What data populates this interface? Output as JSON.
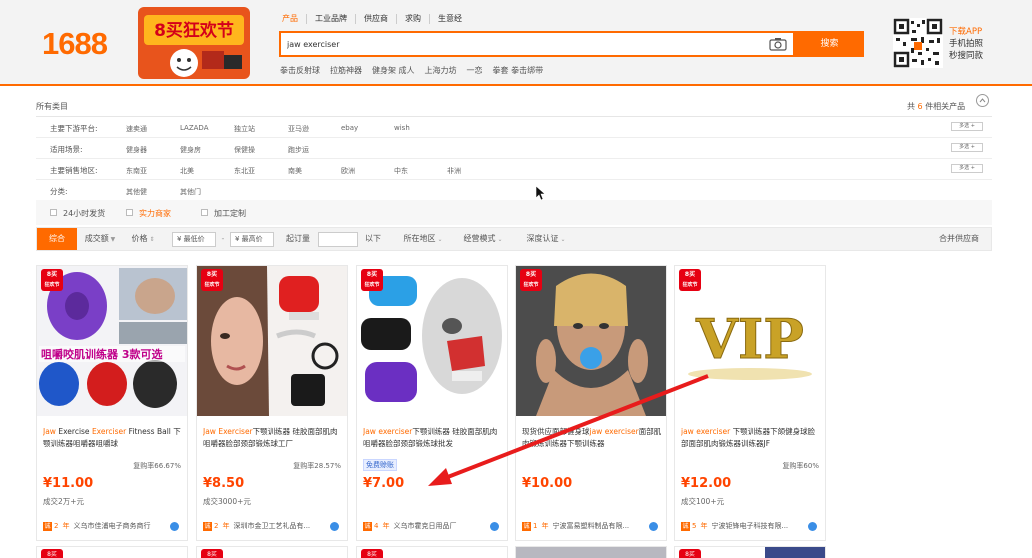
{
  "header": {
    "logo": "1688",
    "promo": {
      "line1": "8买狂欢节"
    },
    "search_tabs": [
      "产品",
      "工业品牌",
      "供应商",
      "求购",
      "生意经"
    ],
    "search_value": "jaw exerciser",
    "search_button": "搜索",
    "hot_words": [
      "拳击反射球",
      "拉筋神器",
      "健身架 成人",
      "上海力坊",
      "一恋",
      "拳套 拳击绑带"
    ],
    "app": {
      "line1": "下载APP",
      "line2": "手机拍照",
      "line3": "秒搜同款"
    }
  },
  "filters": {
    "all_categories": "所有类目",
    "result_prefix": "共",
    "result_count": "6",
    "result_suffix": "件相关产品",
    "rows": [
      {
        "label": "主要下游平台:",
        "options": [
          "速卖通",
          "LAZADA",
          "独立站",
          "亚马逊",
          "ebay",
          "wish"
        ],
        "more": "多选 +"
      },
      {
        "label": "适用场景:",
        "options": [
          "健身器",
          "健身房",
          "保健操",
          "跑步运"
        ],
        "more": "多选 +"
      },
      {
        "label": "主要销售地区:",
        "options": [
          "东南亚",
          "北美",
          "东北亚",
          "南美",
          "欧洲",
          "中东",
          "非洲"
        ],
        "more": "多选 +"
      },
      {
        "label": "分类:",
        "options": [
          "其他健",
          "其他门"
        ],
        "more": ""
      }
    ],
    "features": [
      "24小时发货",
      "实力商家",
      "加工定制"
    ],
    "colors": {
      "accent": "#ff6a00",
      "feature_highlight": "#ff6a00"
    }
  },
  "sort_bar": {
    "comprehensive": "综合",
    "volume": "成交额",
    "price": "价格",
    "min_price": "¥ 最低价",
    "dash": "-",
    "max_price": "¥ 最高价",
    "start_qty": "起订量",
    "below": "以下",
    "region": "所在地区",
    "business_mode": "经营模式",
    "certification": "深度认证",
    "merge_suppliers": "合并供应商"
  },
  "products": [
    {
      "title_hl": "Jaw",
      "title_rest1": " Exercise ",
      "title_hl2": "Exerciser",
      "title_rest2": " Fitness Ball 下颚训练器咀嚼器咀嚼球",
      "repurchase": "复购率66.67%",
      "free_tag": "",
      "price": "¥11.00",
      "sold": "成交2万+元",
      "years": "2",
      "supplier": "义乌市佳浦电子商务商行",
      "image_overlay": "咀嚼咬肌训练器 3款可选"
    },
    {
      "title_hl": "Jaw",
      "title_rest1": " ",
      "title_hl2": "Exerciser",
      "title_rest2": "下颚训练器 硅胶面部肌肉咀嚼器脸部颈部锻炼球工厂",
      "repurchase": "复购率28.57%",
      "free_tag": "",
      "price": "¥8.50",
      "sold": "成交3000+元",
      "years": "2",
      "supplier": "深圳市金卫工艺礼品有...",
      "image_overlay": ""
    },
    {
      "title_hl": "Jaw",
      "title_rest1": " ",
      "title_hl2": "exerciser",
      "title_rest2": "下颚训练器 硅胶面部肌肉咀嚼器脸部颈部锻炼球批发",
      "repurchase": "",
      "free_tag": "免费赊账",
      "price": "¥7.00",
      "sold": "",
      "years": "4",
      "supplier": "义乌市霍克日用品厂",
      "image_overlay": ""
    },
    {
      "title_hl": "",
      "title_rest1": "现货供应面部健身球",
      "title_hl2": "jaw exerciser",
      "title_rest2": "面部肌肉锻炼训练器下颚训练器",
      "repurchase": "",
      "free_tag": "",
      "price": "¥10.00",
      "sold": "",
      "years": "1",
      "supplier": "宁波富易塑料制品有限...",
      "image_overlay": ""
    },
    {
      "title_hl": "jaw",
      "title_rest1": " ",
      "title_hl2": "exerciser",
      "title_rest2": " 下颚训练器下颌健身球脸部面部肌肉锻炼器训练器JF",
      "repurchase": "复购率60%",
      "free_tag": "",
      "price": "¥12.00",
      "sold": "成交100+元",
      "years": "5",
      "supplier": "宁波钜锋电子科技有限...",
      "image_overlay": "VIP"
    }
  ],
  "badge_text": {
    "line1": "8买",
    "line2": "狂欢节"
  }
}
